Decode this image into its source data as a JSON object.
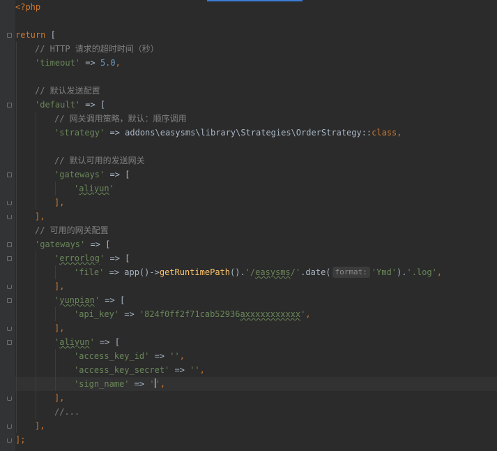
{
  "editor": {
    "lines": {
      "l1": "<?php",
      "l3_kw": "return",
      "l3_rest": " [",
      "l4": "// HTTP 请求的超时时间（秒）",
      "l5_key": "'timeout'",
      "l5_op": " => ",
      "l5_num": "5.0",
      "l5_end": ",",
      "l7": "// 默认发送配置",
      "l8_key": "'default'",
      "l8_op": " => [",
      "l9": "// 网关调用策略，默认：顺序调用",
      "l10_key": "'strategy'",
      "l10_op": " => addons\\easysms\\library\\Strategies\\OrderStrategy::",
      "l10_kw": "class",
      "l10_end": ",",
      "l12": "// 默认可用的发送网关",
      "l13_key": "'gateways'",
      "l13_op": " => [",
      "l14_q1": "'",
      "l14_word": "aliyun",
      "l14_q2": "'",
      "l15": "],",
      "l16": "],",
      "l17": "// 可用的网关配置",
      "l18_key": "'gateways'",
      "l18_op": " => [",
      "l19_q1": "'",
      "l19_word": "errorlog",
      "l19_q2": "'",
      "l19_op": " => [",
      "l20_key": "'file'",
      "l20_op": " => app()->",
      "l20_fn": "getRuntimePath",
      "l20_p1": "().",
      "l20_s1a": "'/",
      "l20_s1w": "easysms",
      "l20_s1b": "/'",
      "l20_p2": ".date(",
      "l20_hint": "format:",
      "l20_s2": "'Ymd'",
      "l20_p3": ").",
      "l20_s3": "'.log'",
      "l20_end": ",",
      "l21": "],",
      "l22_q1": "'",
      "l22_word": "yunpian",
      "l22_q2": "'",
      "l22_op": " => [",
      "l23_key": "'api_key'",
      "l23_op": " => ",
      "l23_sa": "'824f0ff2f71cab52936",
      "l23_sw": "axxxxxxxxxxx",
      "l23_sb": "'",
      "l23_end": ",",
      "l24": "],",
      "l25_q1": "'",
      "l25_word": "aliyun",
      "l25_q2": "'",
      "l25_op": " => [",
      "l26_key": "'access_key_id'",
      "l26_op": " => ",
      "l26_val": "''",
      "l26_end": ",",
      "l27_key": "'access_key_secret'",
      "l27_op": " => ",
      "l27_val": "''",
      "l27_end": ",",
      "l28_key": "'sign_name'",
      "l28_op": " => ",
      "l28_q1": "'",
      "l28_q2": "'",
      "l28_end": ",",
      "l29": "],",
      "l30": "//...",
      "l31": "],",
      "l32": "];"
    }
  }
}
